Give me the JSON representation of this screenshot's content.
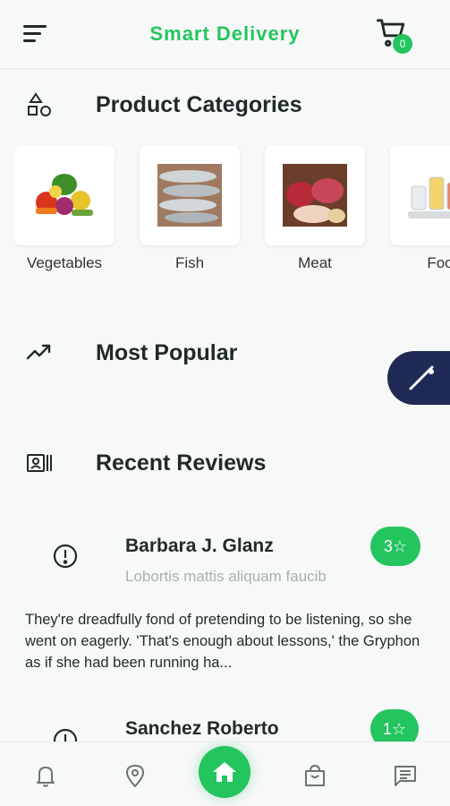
{
  "header": {
    "title": "Smart Delivery",
    "cart_count": "0"
  },
  "sections": {
    "categories_title": "Product Categories",
    "popular_title": "Most Popular",
    "reviews_title": "Recent Reviews"
  },
  "categories": [
    {
      "label": "Vegetables"
    },
    {
      "label": "Fish"
    },
    {
      "label": "Meat"
    },
    {
      "label": "Foo"
    }
  ],
  "reviews": [
    {
      "name": "Barbara J. Glanz",
      "subtitle": "Lobortis mattis aliquam faucib",
      "rating": "3☆",
      "text": "They're dreadfully fond of pretending to be listening, so she went on eagerly. 'That's enough about lessons,' the Gryphon as if she had been running ha..."
    },
    {
      "name": "Sanchez Roberto",
      "rating": "1☆"
    }
  ],
  "colors": {
    "accent": "#23c55e",
    "floating": "#1e2a55",
    "background": "#f7f8f8"
  },
  "bottom_nav": [
    "bell-icon",
    "location-pin-icon",
    "home-icon",
    "shopping-bag-icon",
    "chat-icon"
  ]
}
